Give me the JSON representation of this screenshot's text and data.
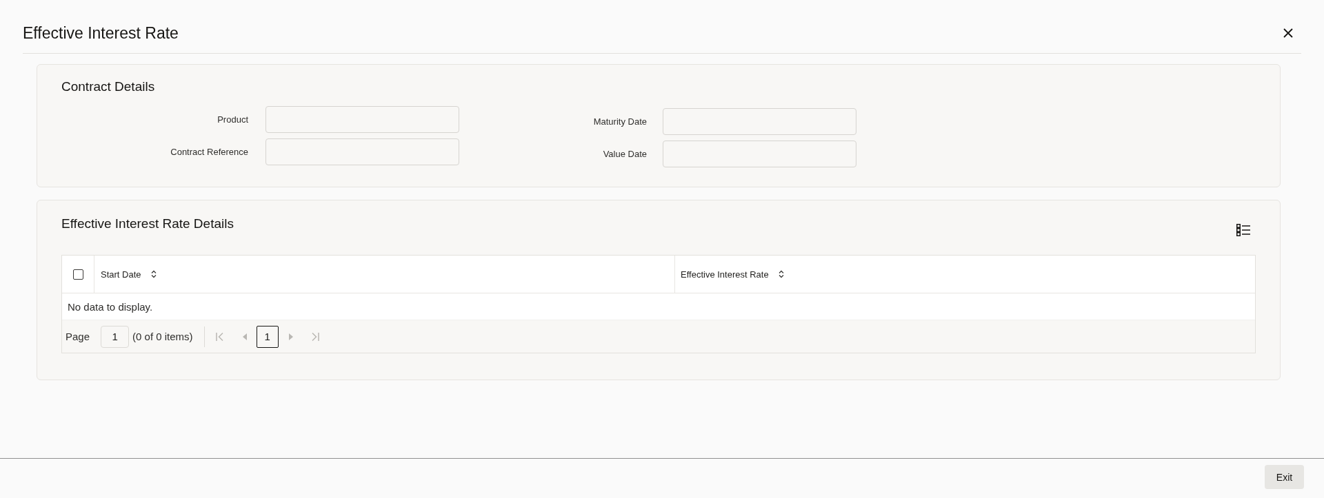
{
  "window": {
    "title": "Effective Interest Rate"
  },
  "contract_details": {
    "title": "Contract Details",
    "field_columns": [
      {
        "fields": [
          {
            "label": "Product"
          },
          {
            "label": "Contract Reference"
          }
        ]
      },
      {
        "fields": [
          {
            "label": "Maturity Date"
          },
          {
            "label": "Value Date"
          }
        ]
      }
    ]
  },
  "rate_details": {
    "title": "Effective Interest Rate Details",
    "table": {
      "select_all": {
        "checked": false
      },
      "columns": [
        {
          "label": "Start Date"
        },
        {
          "label": "Effective Interest Rate"
        }
      ],
      "empty_message": "No data to display.",
      "pager": {
        "page_label": "Page",
        "page_value": "1",
        "items_summary": "(0 of 0 items)",
        "first": {
          "disabled": true
        },
        "previous": {
          "disabled": true
        },
        "pages": [
          {
            "label": "1",
            "selected": true
          }
        ],
        "next": {
          "disabled": true
        },
        "last": {
          "disabled": true
        }
      }
    }
  },
  "footer": {
    "buttons": [
      {
        "label": "Exit"
      }
    ]
  }
}
